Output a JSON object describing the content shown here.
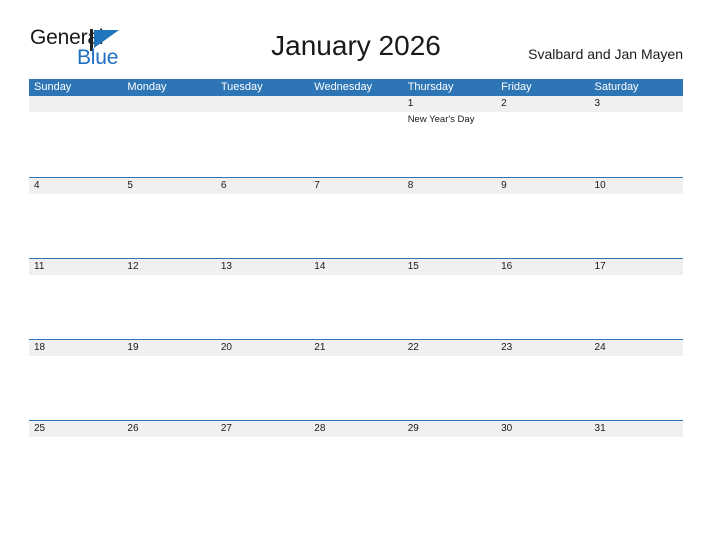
{
  "brand": {
    "name_part1": "General",
    "name_part2": "Blue",
    "flag_icon": "flag-triangle-icon",
    "flag_color": "#2175bc",
    "text_color": "#1a1a1a",
    "blue_color": "#1f6fc4"
  },
  "header": {
    "title": "January 2026",
    "region": "Svalbard and Jan Mayen"
  },
  "theme": {
    "header_blue": "#2e75b6",
    "row_shade": "#f0f0f0",
    "row_divider": "#2e75b6",
    "page_background": "#ffffff"
  },
  "calendar": {
    "weekdays": [
      "Sunday",
      "Monday",
      "Tuesday",
      "Wednesday",
      "Thursday",
      "Friday",
      "Saturday"
    ],
    "weeks": [
      {
        "days": [
          {
            "number": "",
            "events": []
          },
          {
            "number": "",
            "events": []
          },
          {
            "number": "",
            "events": []
          },
          {
            "number": "",
            "events": []
          },
          {
            "number": "1",
            "events": [
              "New Year's Day"
            ]
          },
          {
            "number": "2",
            "events": []
          },
          {
            "number": "3",
            "events": []
          }
        ]
      },
      {
        "days": [
          {
            "number": "4",
            "events": []
          },
          {
            "number": "5",
            "events": []
          },
          {
            "number": "6",
            "events": []
          },
          {
            "number": "7",
            "events": []
          },
          {
            "number": "8",
            "events": []
          },
          {
            "number": "9",
            "events": []
          },
          {
            "number": "10",
            "events": []
          }
        ]
      },
      {
        "days": [
          {
            "number": "11",
            "events": []
          },
          {
            "number": "12",
            "events": []
          },
          {
            "number": "13",
            "events": []
          },
          {
            "number": "14",
            "events": []
          },
          {
            "number": "15",
            "events": []
          },
          {
            "number": "16",
            "events": []
          },
          {
            "number": "17",
            "events": []
          }
        ]
      },
      {
        "days": [
          {
            "number": "18",
            "events": []
          },
          {
            "number": "19",
            "events": []
          },
          {
            "number": "20",
            "events": []
          },
          {
            "number": "21",
            "events": []
          },
          {
            "number": "22",
            "events": []
          },
          {
            "number": "23",
            "events": []
          },
          {
            "number": "24",
            "events": []
          }
        ]
      },
      {
        "days": [
          {
            "number": "25",
            "events": []
          },
          {
            "number": "26",
            "events": []
          },
          {
            "number": "27",
            "events": []
          },
          {
            "number": "28",
            "events": []
          },
          {
            "number": "29",
            "events": []
          },
          {
            "number": "30",
            "events": []
          },
          {
            "number": "31",
            "events": []
          }
        ]
      }
    ]
  }
}
